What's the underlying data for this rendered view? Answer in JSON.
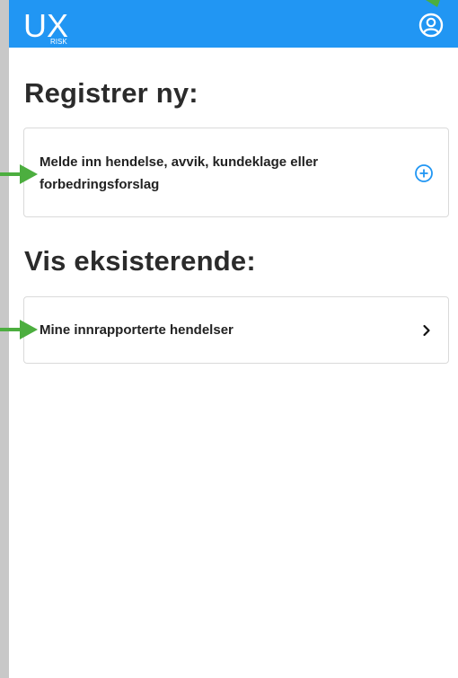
{
  "header": {
    "logo": "UX RISK",
    "logo_main": "UX",
    "logo_sub": "RISK",
    "profile_icon": "account-circle-icon",
    "background_color": "#2196f3"
  },
  "sections": [
    {
      "title": "Registrer ny:",
      "items": [
        {
          "label_line1": "Melde inn hendelse, avvik, kundeklage eller",
          "label_line2": "forbedringsforslag",
          "icon": "plus-circle-icon",
          "icon_color": "#2196f3"
        }
      ]
    },
    {
      "title": "Vis eksisterende:",
      "items": [
        {
          "label": "Mine innrapporterte hendelser",
          "icon": "chevron-right-icon"
        }
      ]
    }
  ],
  "annotation_color": "#4cae3f"
}
